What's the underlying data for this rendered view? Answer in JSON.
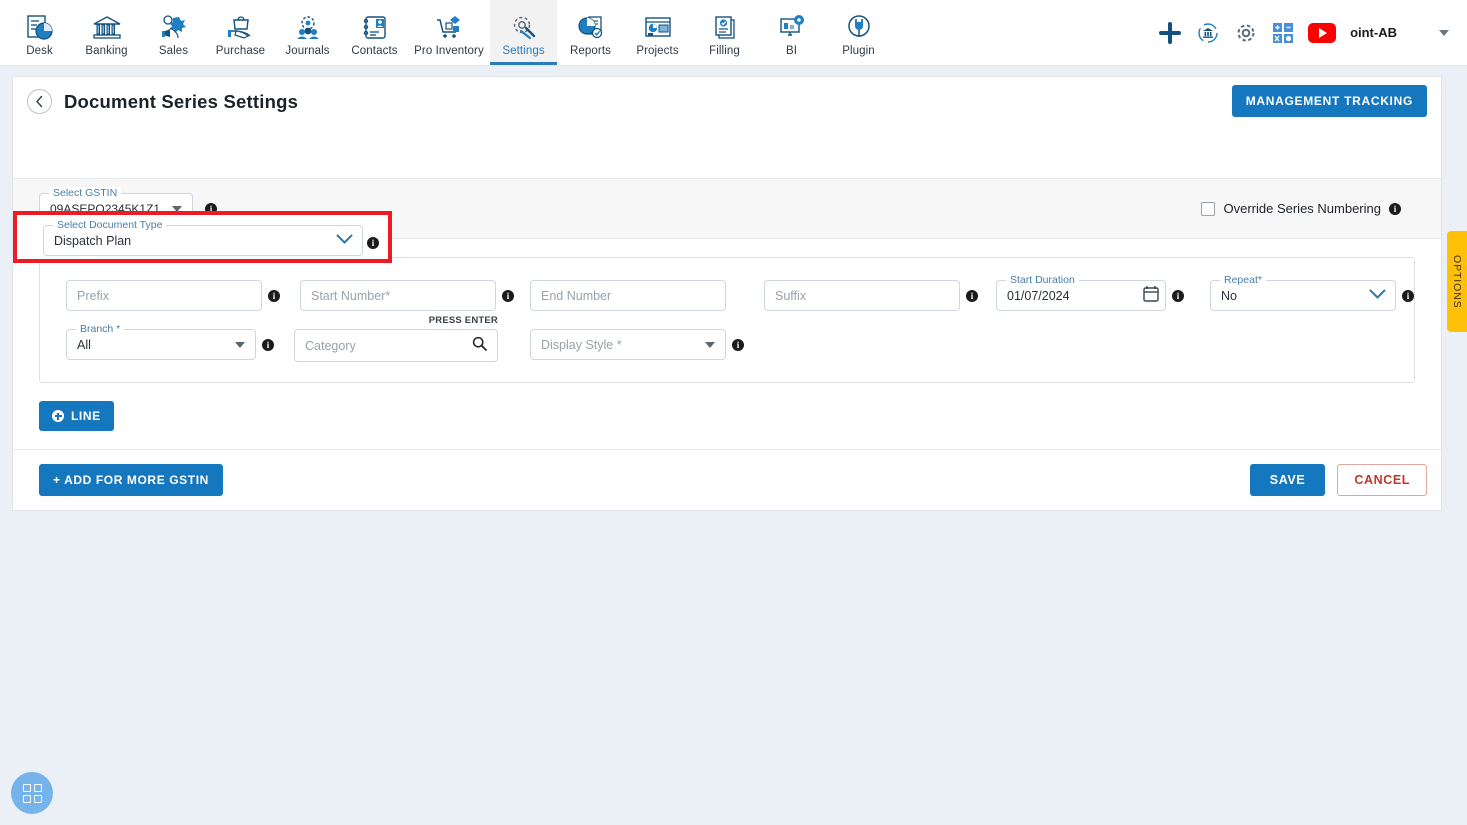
{
  "topnav": {
    "items": [
      {
        "label": "Desk",
        "icon": "desk-chart-icon",
        "active": false
      },
      {
        "label": "Banking",
        "icon": "bank-building-icon",
        "active": false
      },
      {
        "label": "Sales",
        "icon": "sales-megaphone-icon",
        "active": false
      },
      {
        "label": "Purchase",
        "icon": "purchase-bag-hand-icon",
        "active": false
      },
      {
        "label": "Journals",
        "icon": "journals-gear-people-icon",
        "active": false
      },
      {
        "label": "Contacts",
        "icon": "contacts-book-icon",
        "active": false
      },
      {
        "label": "Pro Inventory",
        "icon": "inventory-cart-icon",
        "active": false
      },
      {
        "label": "Settings",
        "icon": "settings-gear-wrench-icon",
        "active": true
      },
      {
        "label": "Reports",
        "icon": "reports-piechart-icon",
        "active": false
      },
      {
        "label": "Projects",
        "icon": "projects-board-icon",
        "active": false
      },
      {
        "label": "Filling",
        "icon": "filling-documents-icon",
        "active": false
      },
      {
        "label": "BI",
        "icon": "bi-monitor-gear-icon",
        "active": false
      },
      {
        "label": "Plugin",
        "icon": "plugin-plug-icon",
        "active": false
      }
    ],
    "right": {
      "add_icon": "plus-icon",
      "org_icon": "organization-refresh-icon",
      "settings_icon": "gear-icon",
      "apps_icon": "calculator-apps-icon",
      "youtube_icon": "youtube-icon",
      "user_name": "oint-AB",
      "chevron_icon": "chevron-down-icon"
    }
  },
  "header": {
    "back_icon": "back-chevron-icon",
    "title": "Document Series Settings",
    "management_tracking_label": "MANAGEMENT TRACKING"
  },
  "document_type": {
    "label": "Select Document Type",
    "value": "Dispatch Plan",
    "chevron_icon": "chevron-down-icon",
    "info_icon": "info-icon",
    "highlight_color": "#ed1c24"
  },
  "gstin": {
    "label": "Select GSTIN",
    "value": "09ASEPQ2345K1Z1",
    "dropdown_icon": "triangle-down-icon",
    "info_icon": "info-icon",
    "override": {
      "label": "Override Series Numbering",
      "checked": false,
      "info_icon": "info-icon"
    }
  },
  "line_form": {
    "row1": [
      {
        "name": "prefix",
        "label": "",
        "placeholder": "Prefix",
        "value": "",
        "info": true
      },
      {
        "name": "start_number",
        "label": "",
        "placeholder": "Start Number*",
        "value": "",
        "info": true
      },
      {
        "name": "end_number",
        "label": "",
        "placeholder": "End Number",
        "value": "",
        "info": false
      },
      {
        "name": "suffix",
        "label": "",
        "placeholder": "Suffix",
        "value": "",
        "info": true
      },
      {
        "name": "start_duration",
        "label": "Start Duration",
        "placeholder": "",
        "value": "01/07/2024",
        "info": true
      },
      {
        "name": "repeat",
        "label": "Repeat*",
        "placeholder": "",
        "value": "No",
        "info": true
      }
    ],
    "row2": {
      "branch": {
        "label": "Branch *",
        "value": "All",
        "info": true
      },
      "category": {
        "placeholder": "Category",
        "hint": "PRESS ENTER",
        "search_icon": "search-icon"
      },
      "display_style": {
        "placeholder": "Display Style *",
        "info": true
      }
    },
    "line_button": "LINE"
  },
  "footer": {
    "add_gstin_label": "+ ADD FOR MORE GSTIN",
    "save_label": "SAVE",
    "cancel_label": "CANCEL"
  },
  "options_tab": {
    "label": "OPTIONS",
    "color": "#ffc107"
  },
  "fab": {
    "icon": "grid-apps-icon",
    "color": "#76b3ea"
  }
}
